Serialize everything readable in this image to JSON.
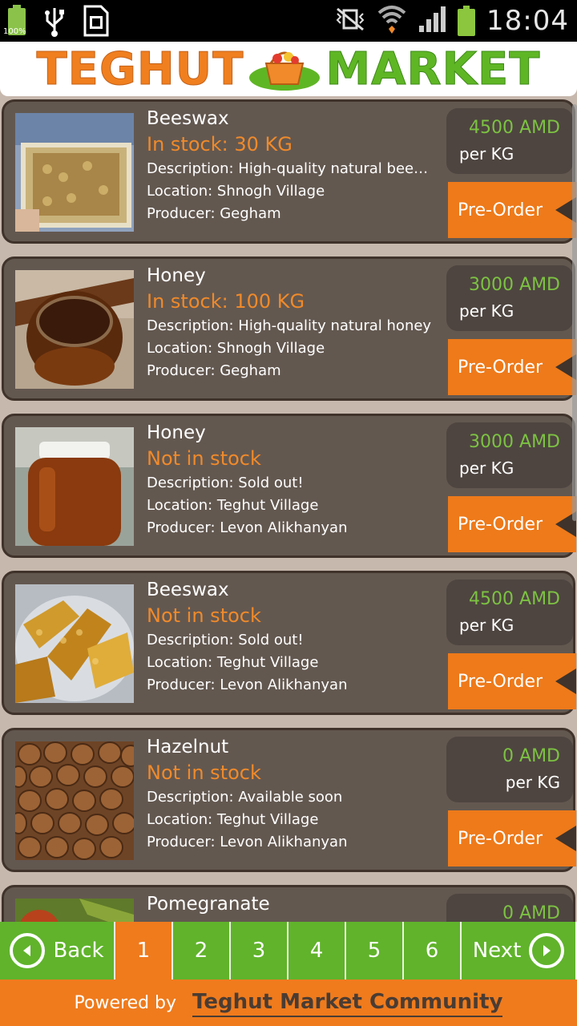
{
  "status_bar": {
    "battery_percent": "100%",
    "time": "18:04"
  },
  "header": {
    "logo_word_1": "TEGHUT",
    "logo_word_2": "MARKET"
  },
  "products": [
    {
      "name": "Beeswax",
      "stock": "In stock: 30 KG",
      "description": "Description: High-quality natural beew...",
      "location": "Location: Shnogh Village",
      "producer": "Producer: Gegham",
      "price": "4500 AMD",
      "unit": "per KG",
      "action": "Pre-Order"
    },
    {
      "name": "Honey",
      "stock": "In stock: 100 KG",
      "description": "Description: High-quality natural honey",
      "location": "Location: Shnogh Village",
      "producer": "Producer: Gegham",
      "price": "3000 AMD",
      "unit": "per KG",
      "action": "Pre-Order"
    },
    {
      "name": "Honey",
      "stock": "Not in stock",
      "description": "Description: Sold out!",
      "location": "Location: Teghut Village",
      "producer": "Producer: Levon Alikhanyan",
      "price": "3000 AMD",
      "unit": "per KG",
      "action": "Pre-Order"
    },
    {
      "name": "Beeswax",
      "stock": "Not in stock",
      "description": "Description: Sold out!",
      "location": "Location: Teghut Village",
      "producer": "Producer: Levon Alikhanyan",
      "price": "4500 AMD",
      "unit": "per KG",
      "action": "Pre-Order"
    },
    {
      "name": "Hazelnut",
      "stock": "Not in stock",
      "description": "Description: Available soon",
      "location": "Location: Teghut Village",
      "producer": "Producer: Levon Alikhanyan",
      "price": "0 AMD",
      "unit": "per KG",
      "action": "Pre-Order"
    },
    {
      "name": "Pomegranate",
      "price": "0 AMD"
    }
  ],
  "pager": {
    "back_label": "Back",
    "pages": [
      "1",
      "2",
      "3",
      "4",
      "5",
      "6"
    ],
    "current_page": "1",
    "next_label": "Next"
  },
  "footer": {
    "powered_by": "Powered by",
    "community": "Teghut Market Community"
  },
  "colors": {
    "accent_orange": "#ef7b1d",
    "accent_green": "#60b32b",
    "price_green": "#7cc242",
    "card_bg": "#635850"
  }
}
